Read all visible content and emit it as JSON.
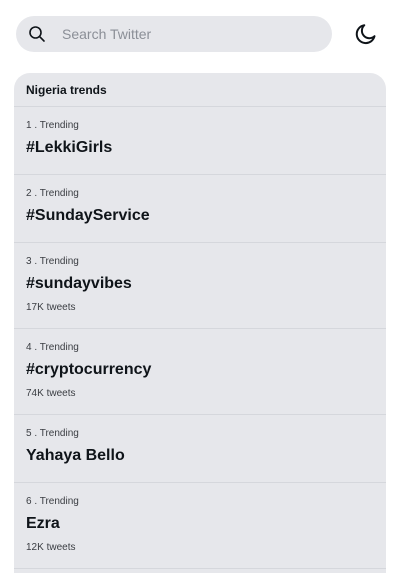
{
  "search": {
    "placeholder": "Search Twitter",
    "icon": "search-icon"
  },
  "theme_toggle": {
    "icon": "moon-icon"
  },
  "trends": {
    "title": "Nigeria trends",
    "items": [
      {
        "meta": "1 . Trending",
        "name": "#LekkiGirls",
        "count": ""
      },
      {
        "meta": "2 . Trending",
        "name": "#SundayService",
        "count": ""
      },
      {
        "meta": "3 . Trending",
        "name": "#sundayvibes",
        "count": "17K tweets"
      },
      {
        "meta": "4 . Trending",
        "name": "#cryptocurrency",
        "count": "74K tweets"
      },
      {
        "meta": "5 . Trending",
        "name": "Yahaya Bello",
        "count": ""
      },
      {
        "meta": "6 . Trending",
        "name": "Ezra",
        "count": "12K tweets"
      }
    ]
  },
  "colors": {
    "panel_bg": "#e6e7eb",
    "divider": "#d5d7dc",
    "text_primary": "#0f1419",
    "text_secondary": "#3a3d42",
    "placeholder": "#8b8f97"
  }
}
